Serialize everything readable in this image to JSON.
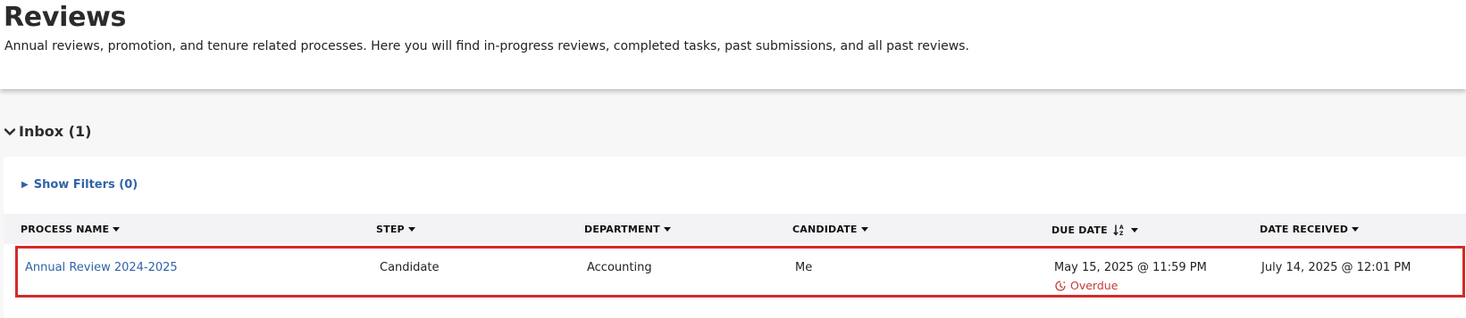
{
  "header": {
    "title": "Reviews",
    "description": "Annual reviews, promotion, and tenure related processes. Here you will find in-progress reviews, completed tasks, past submissions, and all past reviews."
  },
  "inbox": {
    "title": "Inbox (1)",
    "toggle_icon": "chevron-down-icon",
    "filters_label": "Show Filters (0)",
    "columns": [
      "PROCESS NAME",
      "STEP",
      "DEPARTMENT",
      "CANDIDATE",
      "DUE DATE",
      "DATE RECEIVED"
    ],
    "rows": [
      {
        "process_name": "Annual Review 2024-2025",
        "step": "Candidate",
        "department": "Accounting",
        "candidate": "Me",
        "due_date": "May 15, 2025 @ 11:59 PM",
        "status": "Overdue",
        "date_received": "July 14, 2025 @ 12:01 PM"
      }
    ]
  },
  "colors": {
    "link": "#2f63a8",
    "overdue": "#c63b3b",
    "highlight_border": "#d42a2a",
    "table_header_bg": "#f3f3f5",
    "page_bg": "#f7f7f7"
  }
}
